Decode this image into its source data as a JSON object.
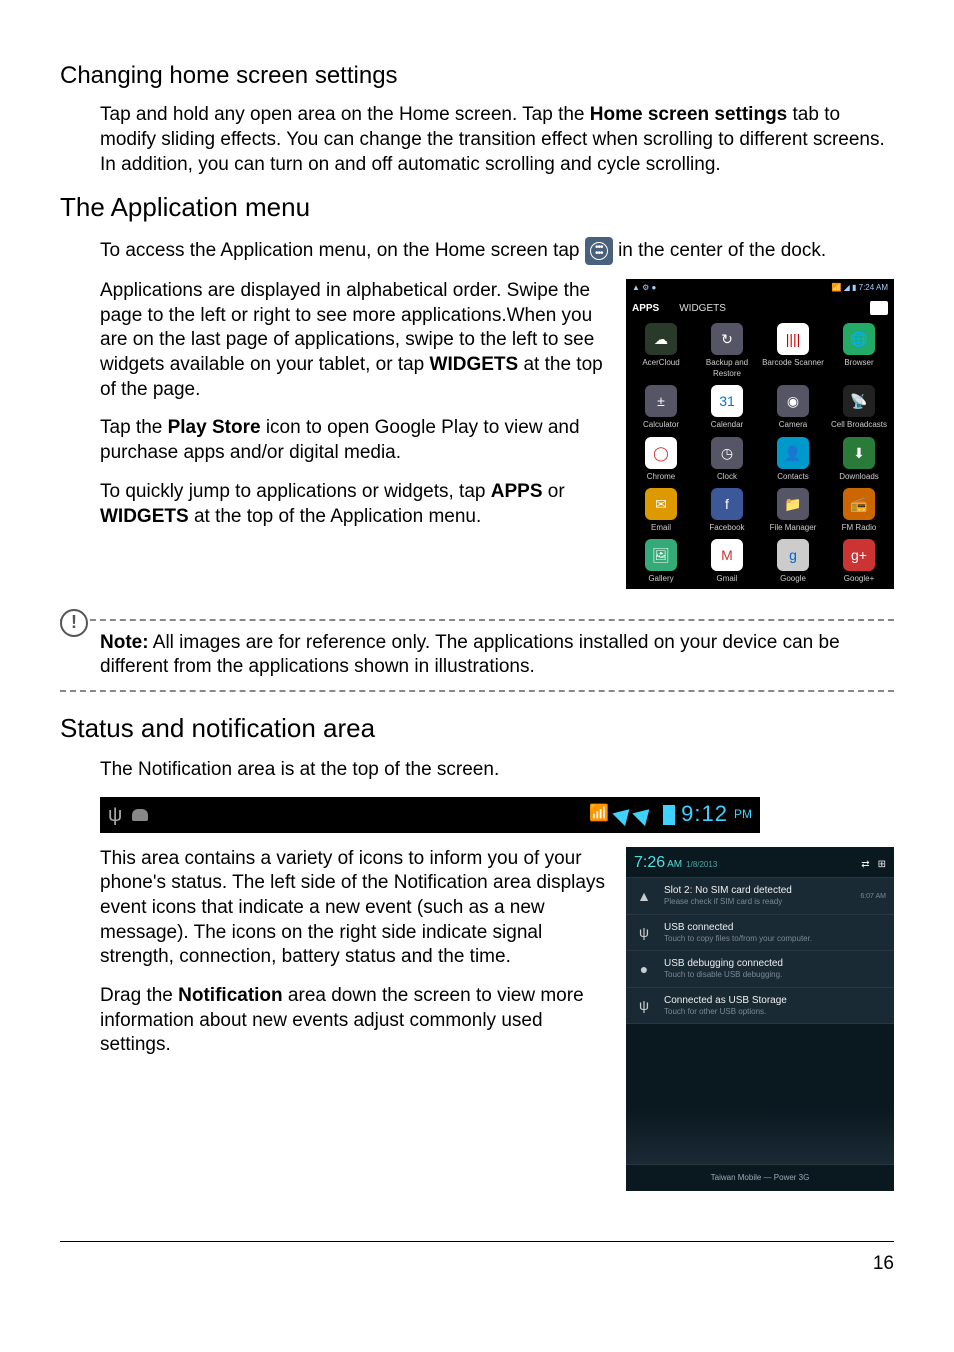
{
  "sections": {
    "changing_home": {
      "heading": "Changing home screen settings",
      "p1_a": "Tap and hold any open area on the Home screen. Tap the ",
      "p1_bold": "Home screen settings",
      "p1_b": " tab to modify sliding effects. You can change the transition effect when scrolling to different screens. In addition, you can turn on and off automatic scrolling and cycle scrolling."
    },
    "app_menu": {
      "heading": "The Application menu",
      "p1_a": "To access the Application menu, on the Home screen tap ",
      "p1_b": " in the center of the dock.",
      "p2_a": "Applications are displayed in alphabetical order. Swipe the page to the left or right to see more applications.When you are on the last page of applications, swipe to the left to see widgets available on your tablet, or tap ",
      "p2_bold": "WIDGETS",
      "p2_b": " at the top of the page.",
      "p3_a": "Tap the ",
      "p3_bold": "Play Store",
      "p3_b": " icon to open Google Play to view and purchase apps and/or digital media.",
      "p4_a": "To quickly jump to applications or widgets, tap ",
      "p4_bold1": "APPS",
      "p4_mid": " or ",
      "p4_bold2": "WIDGETS",
      "p4_b": " at the top of the Application menu."
    },
    "note": {
      "label": "Note:",
      "text": " All images are for reference only. The applications installed on your device can be different from the applications shown in illustrations."
    },
    "status_area": {
      "heading": "Status and notification area",
      "p1": "The Notification area is at the top of the screen.",
      "p2": "This area contains a variety of icons to inform you of your phone's status. The left side of the Notification area displays event icons that indicate a new event (such as a new message). The icons on the right side indicate signal strength, connection, battery status and the time.",
      "p3_a": "Drag the ",
      "p3_bold": "Notification",
      "p3_b": " area down the screen to view more information about new events adjust commonly used settings."
    }
  },
  "apps_screenshot": {
    "status_left": "▲  ⚙  ●",
    "status_right": "📶 ◢ ▮ 7:24 AM",
    "tab_apps": "APPS",
    "tab_widgets": "WIDGETS",
    "apps": [
      {
        "label": "AcerCloud",
        "bg": "#2a3a2a",
        "glyph": "☁"
      },
      {
        "label": "Backup and Restore",
        "bg": "#556",
        "glyph": "↻"
      },
      {
        "label": "Barcode Scanner",
        "bg": "#fff",
        "glyph": "||||",
        "fg": "#c00"
      },
      {
        "label": "Browser",
        "bg": "#2a6",
        "glyph": "🌐"
      },
      {
        "label": "Calculator",
        "bg": "#556",
        "glyph": "±"
      },
      {
        "label": "Calendar",
        "bg": "#fff",
        "glyph": "31",
        "fg": "#07c"
      },
      {
        "label": "Camera",
        "bg": "#556",
        "glyph": "◉"
      },
      {
        "label": "Cell Broadcasts",
        "bg": "#222",
        "glyph": "📡"
      },
      {
        "label": "Chrome",
        "bg": "#fff",
        "glyph": "◯",
        "fg": "#c33"
      },
      {
        "label": "Clock",
        "bg": "#556",
        "glyph": "◷"
      },
      {
        "label": "Contacts",
        "bg": "#09c",
        "glyph": "👤"
      },
      {
        "label": "Downloads",
        "bg": "#2a7a3a",
        "glyph": "⬇"
      },
      {
        "label": "Email",
        "bg": "#d90",
        "glyph": "✉"
      },
      {
        "label": "Facebook",
        "bg": "#3b5998",
        "glyph": "f"
      },
      {
        "label": "File Manager",
        "bg": "#556",
        "glyph": "📁"
      },
      {
        "label": "FM Radio",
        "bg": "#c60",
        "glyph": "📻"
      },
      {
        "label": "Gallery",
        "bg": "#3a7",
        "glyph": "🖼"
      },
      {
        "label": "Gmail",
        "bg": "#fff",
        "glyph": "M",
        "fg": "#c33"
      },
      {
        "label": "Google",
        "bg": "#ccc",
        "glyph": "g",
        "fg": "#06c"
      },
      {
        "label": "Google+",
        "bg": "#c33",
        "glyph": "g+"
      }
    ]
  },
  "statusbar": {
    "time": "9:12",
    "suffix": "PM"
  },
  "notif_panel": {
    "time": "7:26",
    "ampm": "AM",
    "date": "1/8/2013",
    "rows": [
      {
        "icon": "▲",
        "title": "Slot 2: No SIM card detected",
        "sub": "Please check if SIM card is ready",
        "time": "6:07 AM"
      },
      {
        "icon": "ψ",
        "title": "USB connected",
        "sub": "Touch to copy files to/from your computer.",
        "time": ""
      },
      {
        "icon": "●",
        "title": "USB debugging connected",
        "sub": "Touch to disable USB debugging.",
        "time": ""
      },
      {
        "icon": "ψ",
        "title": "Connected as USB Storage",
        "sub": "Touch for other USB options.",
        "time": ""
      }
    ],
    "footer": "Taiwan Mobile — Power 3G"
  },
  "page_number": "16"
}
